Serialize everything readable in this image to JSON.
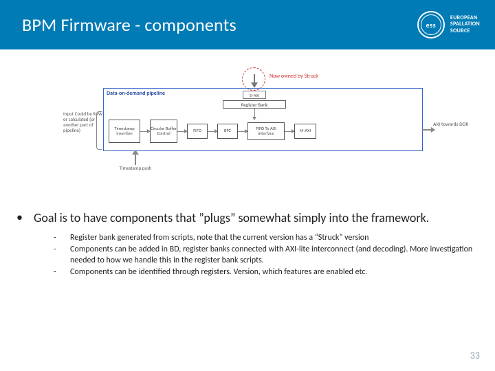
{
  "header": {
    "title": "BPM Firmware - components",
    "logo_abbr": "ess",
    "logo_line1": "EUROPEAN",
    "logo_line2": "SPALLATION",
    "logo_line3": "SOURCE"
  },
  "diagram": {
    "outer_label": "Data-on-demand pipeline",
    "annotation": "Now owned by Struck",
    "slaxi": "SI-AXI",
    "regbank": "Register Bank",
    "input_text": "Input\nCould be RAW or calculated (or another part of pipeline)",
    "ts_box": "Timestamp insertion",
    "cbc_box": "Circular Buffer Control",
    "fifo1": "FIFO",
    "bfc": "BFC",
    "fifo2": "FIFO\nTo AXI interface",
    "maxi": "M-AXI",
    "ts_push": "Timestamp push",
    "axi_out": "AXI towards DDR"
  },
  "content": {
    "goal": "Goal is to have components that ”plugs” somewhat simply into the framework.",
    "subs": [
      "Register bank generated from scripts, note that the current version has a “Struck” version",
      "Components can be added in BD, register banks connected with AXI-lite interconnect (and decoding). More investigation needed to how we handle this in the register bank scripts.",
      "Components can be identified through registers. Version, which features are enabled etc."
    ]
  },
  "page_number": "33"
}
